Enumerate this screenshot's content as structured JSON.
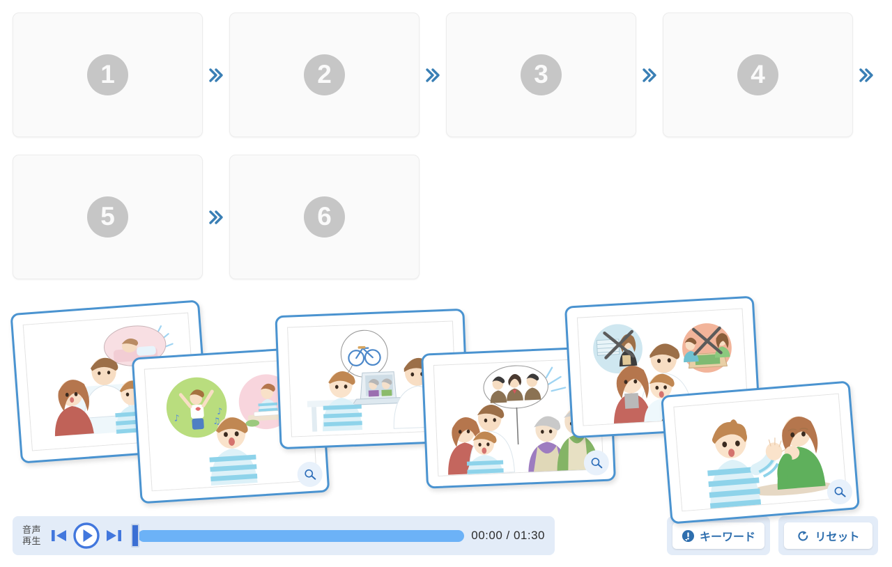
{
  "sequence": {
    "slots": [
      {
        "number": "1",
        "name": "slot-1"
      },
      {
        "number": "2",
        "name": "slot-2"
      },
      {
        "number": "3",
        "name": "slot-3"
      },
      {
        "number": "4",
        "name": "slot-4"
      },
      {
        "number": "5",
        "name": "slot-5"
      },
      {
        "number": "6",
        "name": "slot-6"
      }
    ],
    "arrow_icon": "double-chevron-right-icon",
    "slot_accent_color": "#c6c6c6",
    "arrow_color": "#3a7fb5"
  },
  "cards": [
    {
      "id": "card-1",
      "alt": "Family with father, mother and boy; thought bubble of person sleeping in bed",
      "has_zoom": false,
      "zoom_icon": "magnifier-icon"
    },
    {
      "id": "card-2",
      "alt": "Boy with two thought bubbles: green circle with girl playing, pink circle with girl studying",
      "has_zoom": true,
      "zoom_icon": "magnifier-icon"
    },
    {
      "id": "card-3",
      "alt": "Boy and man at desk with laptop video call to grandparents; bicycle thought bubble",
      "has_zoom": true,
      "zoom_icon": "magnifier-icon"
    },
    {
      "id": "card-4",
      "alt": "Family and elderly couple; thought bubble with three school children",
      "has_zoom": true,
      "zoom_icon": "magnifier-icon"
    },
    {
      "id": "card-5",
      "alt": "Family with two crossed-out thought bubbles: shopping and board game",
      "has_zoom": false,
      "zoom_icon": "magnifier-icon"
    },
    {
      "id": "card-6",
      "alt": "Boy in striped shirt talking with woman in green sweater resting her chin",
      "has_zoom": true,
      "zoom_icon": "magnifier-icon"
    }
  ],
  "audio": {
    "label_line1": "音声",
    "label_line2": "再生",
    "prev_icon": "skip-previous-icon",
    "play_icon": "play-circle-icon",
    "next_icon": "skip-next-icon",
    "time_display": "00:00 / 01:30",
    "current_time": "00:00",
    "total_time": "01:30",
    "progress_percent": 0,
    "accent_color": "#4277dd",
    "track_color": "#6cb2f7",
    "panel_color": "#e3ecf8"
  },
  "actions": {
    "keyword": {
      "label": "キーワード",
      "icon": "exclamation-bubble-icon"
    },
    "reset": {
      "label": "リセット",
      "icon": "refresh-icon"
    },
    "text_color": "#2f6fae"
  }
}
